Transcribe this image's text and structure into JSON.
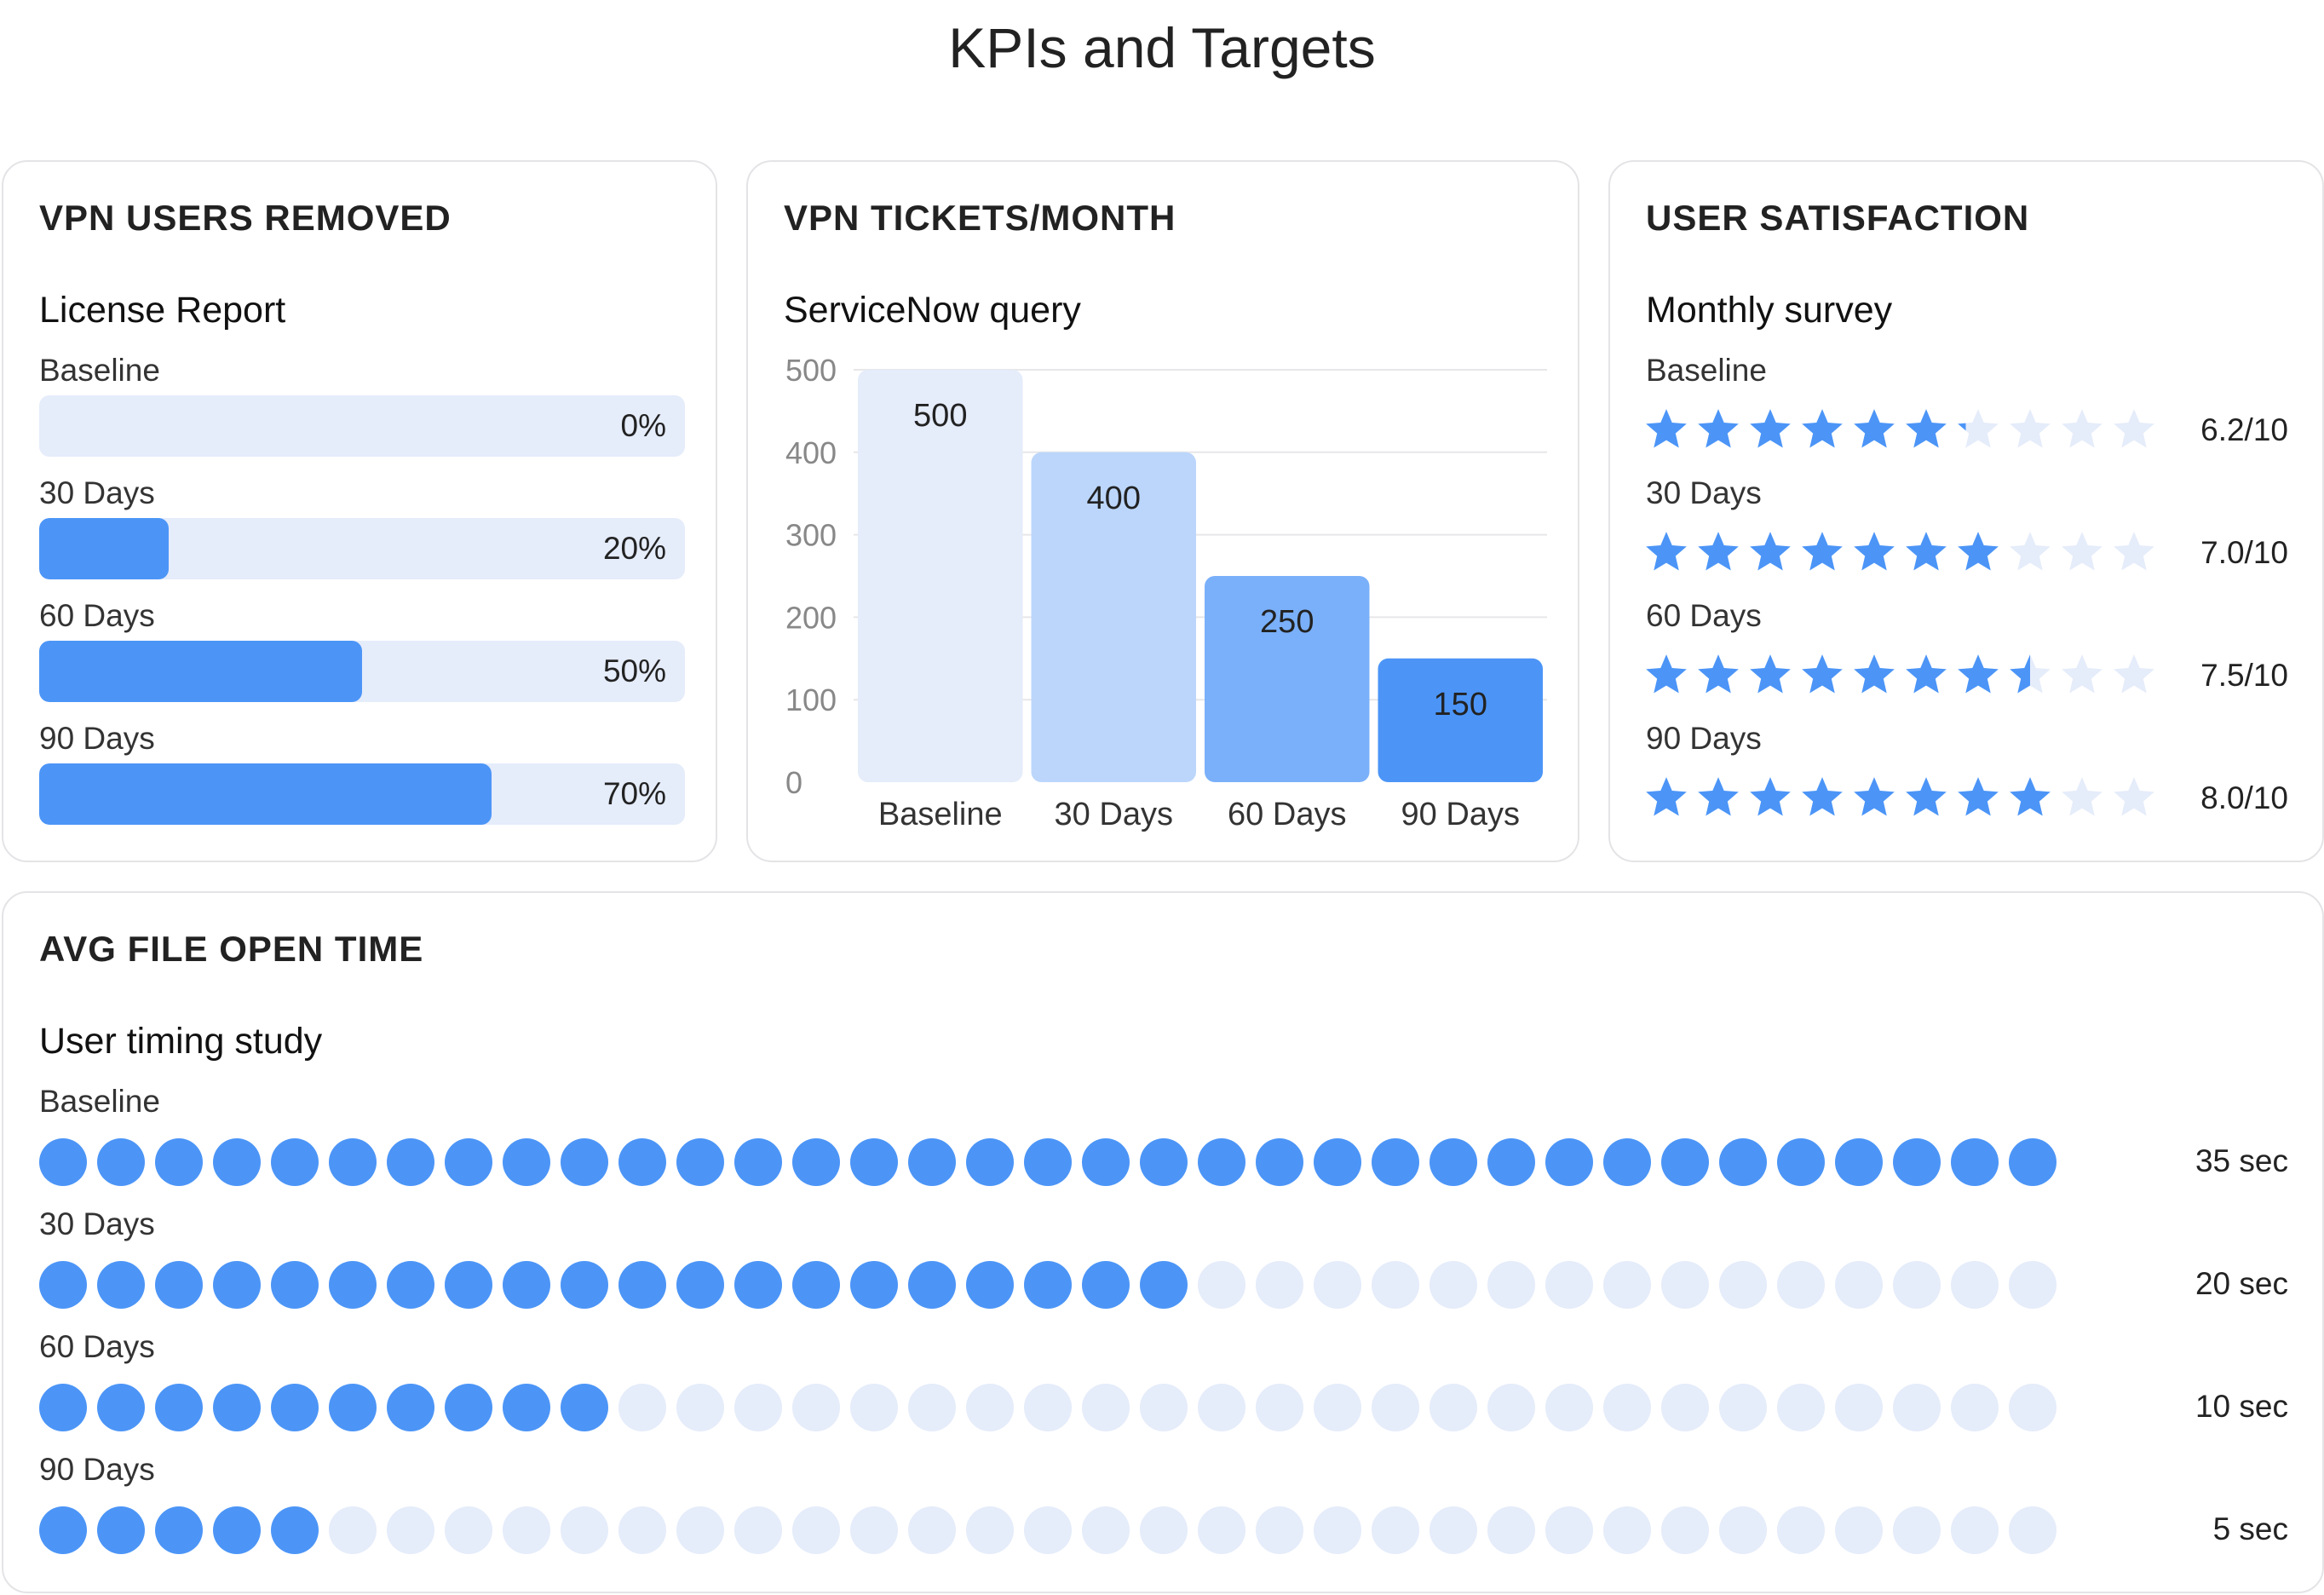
{
  "page": {
    "title": "KPIs and Targets"
  },
  "colors": {
    "accent": "#4c95f7",
    "track": "#e5ecfa",
    "bar_shades": [
      "#e5ecfa",
      "#bcd6fb",
      "#7ab0f9",
      "#4c95f7"
    ]
  },
  "cards": {
    "vpn_users": {
      "title": "VPN USERS REMOVED",
      "subtitle": "License Report",
      "rows": [
        {
          "label": "Baseline",
          "value": 0,
          "display": "0%"
        },
        {
          "label": "30 Days",
          "value": 20,
          "display": "20%"
        },
        {
          "label": "60 Days",
          "value": 50,
          "display": "50%"
        },
        {
          "label": "90 Days",
          "value": 70,
          "display": "70%"
        }
      ]
    },
    "vpn_tickets": {
      "title": "VPN TICKETS/MONTH",
      "subtitle": "ServiceNow query"
    },
    "satisfaction": {
      "title": "USER SATISFACTION",
      "subtitle": "Monthly survey",
      "max_stars": 10,
      "rows": [
        {
          "label": "Baseline",
          "value": 6.2,
          "display": "6.2/10"
        },
        {
          "label": "30 Days",
          "value": 7.0,
          "display": "7.0/10"
        },
        {
          "label": "60 Days",
          "value": 7.5,
          "display": "7.5/10"
        },
        {
          "label": "90 Days",
          "value": 8.0,
          "display": "8.0/10"
        }
      ]
    },
    "file_open": {
      "title": "AVG FILE OPEN TIME",
      "subtitle": "User timing study",
      "max_dots": 35,
      "rows": [
        {
          "label": "Baseline",
          "value": 35,
          "display": "35 sec"
        },
        {
          "label": "30 Days",
          "value": 20,
          "display": "20 sec"
        },
        {
          "label": "60 Days",
          "value": 10,
          "display": "10 sec"
        },
        {
          "label": "90 Days",
          "value": 5,
          "display": "5 sec"
        }
      ]
    }
  },
  "chart_data": {
    "type": "bar",
    "categories": [
      "Baseline",
      "30 Days",
      "60 Days",
      "90 Days"
    ],
    "values": [
      500,
      400,
      250,
      150
    ],
    "ylim": [
      0,
      500
    ],
    "yticks": [
      0,
      100,
      200,
      300,
      400,
      500
    ],
    "grid": true,
    "data_labels": true
  }
}
